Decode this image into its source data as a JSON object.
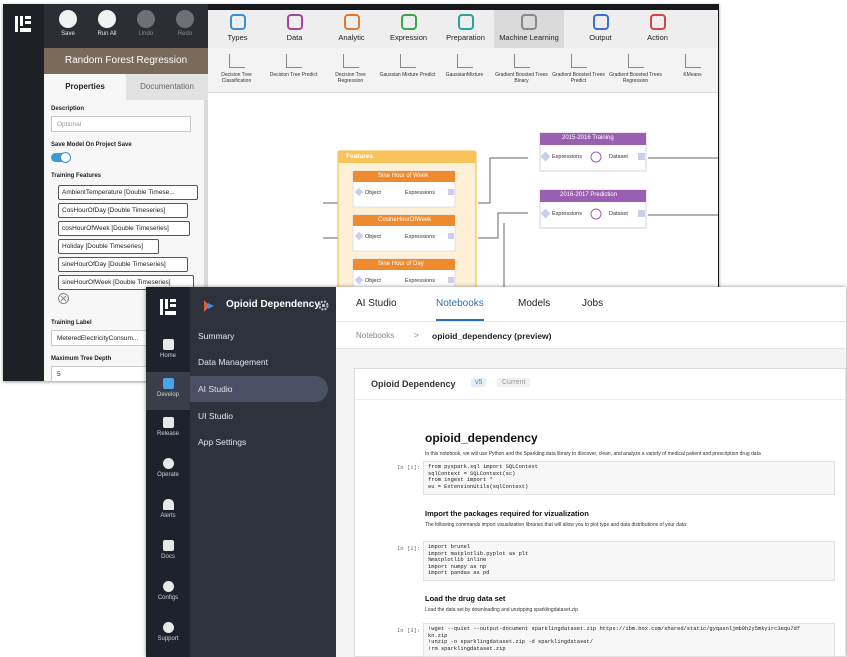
{
  "back_window": {
    "toolbar": {
      "save": "Save",
      "run_all": "Run All",
      "undo": "Undo",
      "redo": "Redo"
    },
    "panel_title": "Random Forest Regression",
    "tabs": {
      "properties": "Properties",
      "documentation": "Documentation"
    },
    "description_label": "Description",
    "description_placeholder": "Optional",
    "save_model_label": "Save Model On Project Save",
    "training_features_label": "Training Features",
    "training_features": [
      "AmbientTemperature [Double Timese...",
      "CosHourOfDay [Double Timeseries]",
      "cosHourOfWeek [Double Timeseries]",
      "Holiday [Double Timeseries]",
      "sineHourOfDay [Double Timeseries]",
      "sineHourOfWeek [Double Timeseries]"
    ],
    "training_label_label": "Training Label",
    "training_label_value": "MeteredElectricityConsum...",
    "max_tree_depth_label": "Maximum Tree Depth",
    "max_tree_depth_value": "5",
    "categories": [
      {
        "label": "Types",
        "color": "#3a8fd6"
      },
      {
        "label": "Data",
        "color": "#a4469a"
      },
      {
        "label": "Analytic",
        "color": "#e07a2c"
      },
      {
        "label": "Expression",
        "color": "#3fa34d"
      },
      {
        "label": "Preparation",
        "color": "#2aa39a"
      },
      {
        "label": "Machine Learning",
        "color": "#888888"
      },
      {
        "label": "Output",
        "color": "#3a6fd6"
      },
      {
        "label": "Action",
        "color": "#d64545"
      }
    ],
    "sub_items": [
      "Decision Tree Classification",
      "Decision Tree Predict",
      "Decision Tree Regression",
      "Gaussian Mixture Predict",
      "GaussianMixture",
      "Gradient Boosted Trees Binary",
      "Gradient Boosted Trees Predict",
      "Gradient Boosted Trees Regression",
      "KMeans"
    ],
    "canvas": {
      "features_group": "Features",
      "nodes": [
        "Sine Hour of Week",
        "CosineHourOfWeek",
        "Sine Hour of Day"
      ],
      "object_label": "Object",
      "expressions_label": "Expressions",
      "dataset_label": "Dataset",
      "training_node": "2015-2016 Training",
      "prediction_node": "2016-2017 Prediction"
    }
  },
  "front_window": {
    "project_name": "Opioid Dependency",
    "rail_items": [
      "Home",
      "Develop",
      "Release",
      "Operate",
      "Alerts",
      "Docs",
      "Configs",
      "Support"
    ],
    "side_nav": [
      "Summary",
      "Data Management",
      "AI Studio",
      "UI Studio",
      "App Settings"
    ],
    "top_nav": [
      "AI Studio",
      "Notebooks",
      "Models",
      "Jobs"
    ],
    "breadcrumb": {
      "root": "Notebooks",
      "sep": ">",
      "current": "opioid_dependency (preview)"
    },
    "notebook_header": {
      "title": "Opioid Dependency",
      "version": "v5",
      "status": "Current"
    },
    "notebook": {
      "title": "opioid_dependency",
      "intro": "In this notebook, we will use Python and the Sparkling.data library to discover, clean, and analyze a variety of medical patient and prescription drug data",
      "cell1_prompt": "In [1]:",
      "cell1_code": [
        "from pyspark.sql import SQLContext",
        "sqlContext = SQLContext(sc)",
        "from ingest import *",
        "eu = ExtensionUtils(sqlContext)"
      ],
      "section1_title": "Import the packages required for vizualization",
      "section1_text": "The following commands import visualization libraries that will allow you to plot type and data distributions of your data:",
      "cell2_prompt": "In [2]:",
      "cell2_code": [
        "import brunel",
        "import matplotlib.pyplot as plt",
        "%matplotlib inline",
        "import numpy as np",
        "import pandas as pd"
      ],
      "section2_title": "Load the drug data set",
      "section2_text": "Load the data set by downloading and unzipping sparklingdataset.zip",
      "cell3_prompt": "In [3]:",
      "cell3_code": [
        "!wget --quiet --output-document sparklingdataset.zip https://ibm.box.com/shared/static/gyqasnljmb9h2y5mkyirc3equ7df",
        "kn.zip",
        "!unzip -o sparklingdataset.zip -d sparklingdataset/",
        "!rm sparklingdataset.zip"
      ]
    }
  }
}
